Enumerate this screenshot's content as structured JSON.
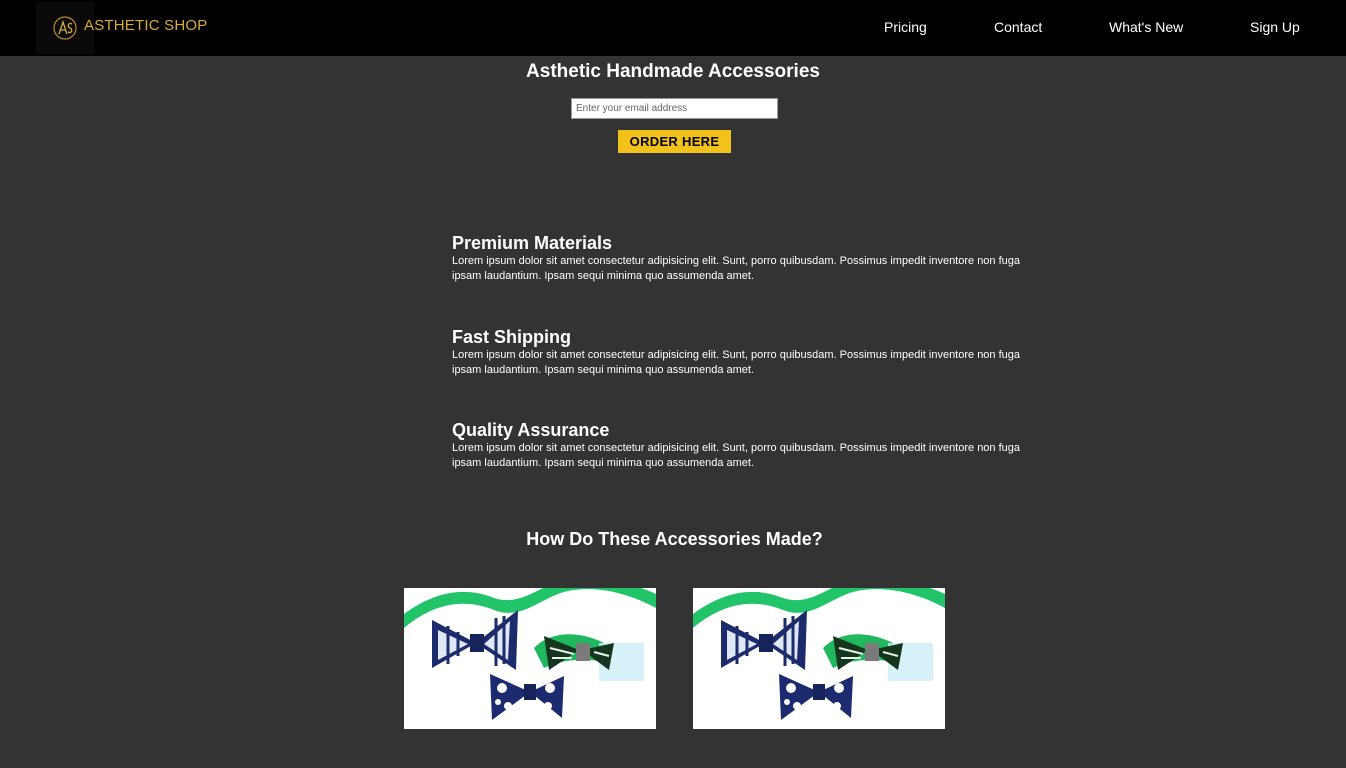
{
  "brand": {
    "name": "ASTHETIC SHOP",
    "accent_color": "#d8ac38"
  },
  "nav": {
    "links": [
      "Pricing",
      "Contact",
      "What's New",
      "Sign Up"
    ]
  },
  "hero": {
    "title": "Asthetic Handmade Accessories",
    "email_placeholder": "Enter your email address",
    "order_button": "ORDER HERE",
    "button_color": "#f2c21a"
  },
  "features": [
    {
      "title": "Premium Materials",
      "text": "Lorem ipsum dolor sit amet consectetur adipisicing elit. Sunt, porro quibusdam. Possimus impedit inventore non fuga ipsam laudantium. Ipsam sequi minima quo assumenda amet."
    },
    {
      "title": "Fast Shipping",
      "text": "Lorem ipsum dolor sit amet consectetur adipisicing elit. Sunt, porro quibusdam. Possimus impedit inventore non fuga ipsam laudantium. Ipsam sequi minima quo assumenda amet."
    },
    {
      "title": "Quality Assurance",
      "text": "Lorem ipsum dolor sit amet consectetur adipisicing elit. Sunt, porro quibusdam. Possimus impedit inventore non fuga ipsam laudantium. Ipsam sequi minima quo assumenda amet."
    }
  ],
  "how_made": {
    "title": "How Do These Accessories Made?",
    "images": [
      "bow-ties-photo",
      "bow-ties-photo"
    ]
  }
}
